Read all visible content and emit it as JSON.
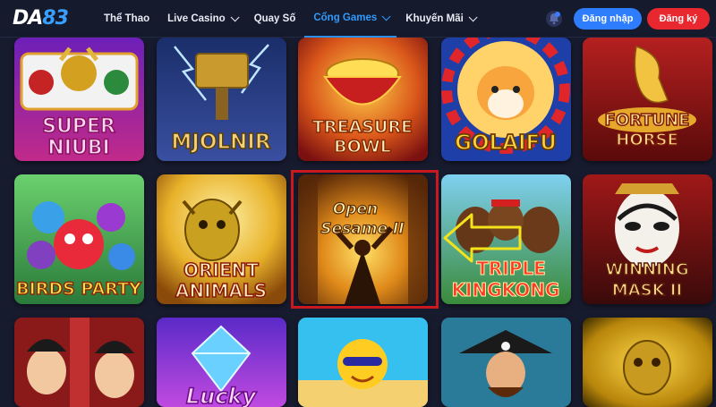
{
  "header": {
    "logo_text": "DA",
    "logo_num": "83",
    "nav": [
      {
        "label": "Thể Thao",
        "has_dropdown": false,
        "active": false
      },
      {
        "label": "Live Casino",
        "has_dropdown": true,
        "active": false
      },
      {
        "label": "Quay Số",
        "has_dropdown": false,
        "active": false
      },
      {
        "label": "Cổng Games",
        "has_dropdown": true,
        "active": true
      },
      {
        "label": "Khuyến Mãi",
        "has_dropdown": true,
        "active": false
      }
    ],
    "notification_icon": "bell-icon",
    "login_label": "Đăng nhập",
    "register_label": "Đăng ký"
  },
  "games": {
    "row1": [
      {
        "line1": "SUPER",
        "line2": "NIUBI"
      },
      {
        "line1": "MJOLNIR",
        "line2": ""
      },
      {
        "line1": "TREASURE",
        "line2": "BOWL"
      },
      {
        "line1": "GOLAIFU",
        "line2": ""
      },
      {
        "line1": "FORTUNE",
        "line2": "HORSE"
      }
    ],
    "row2": [
      {
        "line1": "BIRDS PARTY",
        "line2": ""
      },
      {
        "line1": "ORIENT",
        "line2": "ANIMALS"
      },
      {
        "line1": "Open",
        "line2": "Sesame II"
      },
      {
        "line1": "TRIPLE",
        "line2": "KINGKONG"
      },
      {
        "line1": "WINNING",
        "line2": "MASK II"
      }
    ],
    "row3": [
      {
        "line1": "",
        "line2": ""
      },
      {
        "line1": "Lucky",
        "line2": ""
      },
      {
        "line1": "",
        "line2": ""
      },
      {
        "line1": "",
        "line2": ""
      },
      {
        "line1": "",
        "line2": ""
      }
    ]
  },
  "colors": {
    "accent_blue": "#2f9bff",
    "login_blue": "#2f7dff",
    "register_red": "#e8282e",
    "highlight_red": "#c8191e",
    "arrow_yellow": "#f4e21b"
  }
}
